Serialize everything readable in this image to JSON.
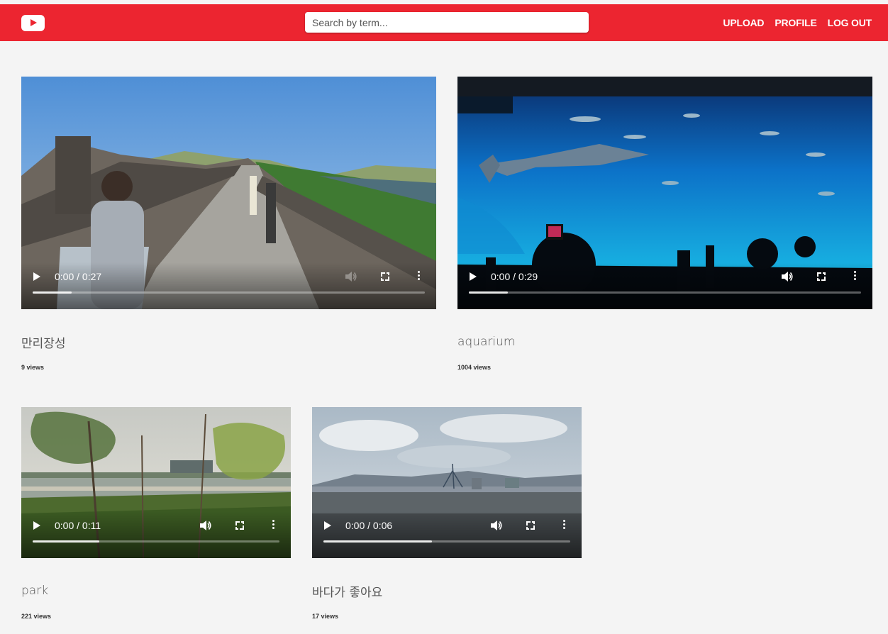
{
  "header": {
    "logo_icon": "play-logo-icon",
    "search_placeholder": "Search by term...",
    "nav": [
      {
        "label": "UPLOAD"
      },
      {
        "label": "PROFILE"
      },
      {
        "label": "LOG OUT"
      }
    ]
  },
  "videos": [
    {
      "title": "만리장성",
      "views": "9 views",
      "time": "0:00 / 0:27",
      "progress": 0.1,
      "scene": "great-wall"
    },
    {
      "title": "aquarium",
      "views": "1004 views",
      "time": "0:00 / 0:29",
      "progress": 0.1,
      "scene": "aquarium"
    },
    {
      "title": "park",
      "views": "221 views",
      "time": "0:00 / 0:11",
      "progress": 0.27,
      "scene": "park"
    },
    {
      "title": "바다가 좋아요",
      "views": "17 views",
      "time": "0:00 / 0:06",
      "progress": 0.44,
      "scene": "bridge"
    }
  ],
  "colors": {
    "header": "#ec2530",
    "background": "#f4f4f4"
  }
}
